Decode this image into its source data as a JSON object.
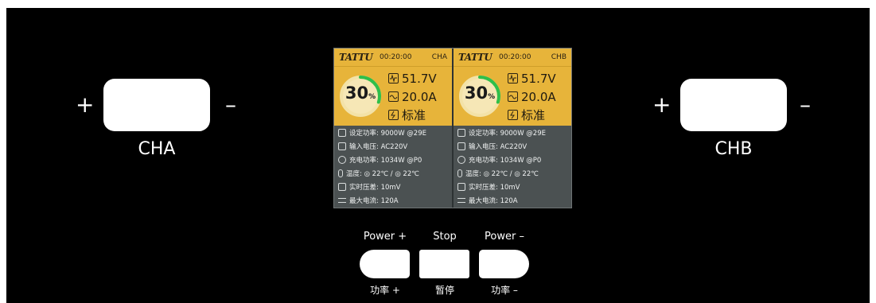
{
  "channels": {
    "a": {
      "label": "CHA",
      "plus": "+",
      "minus": "–"
    },
    "b": {
      "label": "CHB",
      "plus": "+",
      "minus": "–"
    }
  },
  "lcd": {
    "logo": "TATTU",
    "a": {
      "time": "00:20:00",
      "channel": "CHA",
      "percent": "30",
      "percent_unit": "%",
      "percent_value": 30,
      "voltage": "51.7V",
      "current": "20.0A",
      "mode": "标准",
      "info": [
        {
          "icon": "power-setting-icon",
          "text": "设定功率: 9000W  @29E"
        },
        {
          "icon": "input-voltage-icon",
          "text": "输入电压: AC220V"
        },
        {
          "icon": "charge-power-icon",
          "text": "充电功率: 1034W  @P0"
        },
        {
          "icon": "thermometer-icon",
          "text": "温度: ◎ 22℃ / ◎ 22℃"
        },
        {
          "icon": "cell-diff-icon",
          "text": "实时压差: 10mV"
        },
        {
          "icon": "max-current-icon",
          "text": "最大电流: 120A"
        }
      ]
    },
    "b": {
      "time": "00:20:00",
      "channel": "CHB",
      "percent": "30",
      "percent_unit": "%",
      "percent_value": 30,
      "voltage": "51.7V",
      "current": "20.0A",
      "mode": "标准",
      "info": [
        {
          "icon": "power-setting-icon",
          "text": "设定功率: 9000W  @29E"
        },
        {
          "icon": "input-voltage-icon",
          "text": "输入电压: AC220V"
        },
        {
          "icon": "charge-power-icon",
          "text": "充电功率: 1034W  @P0"
        },
        {
          "icon": "thermometer-icon",
          "text": "温度: ◎ 22℃ / ◎ 22℃"
        },
        {
          "icon": "cell-diff-icon",
          "text": "实时压差: 10mV"
        },
        {
          "icon": "max-current-icon",
          "text": "最大电流: 120A"
        }
      ]
    }
  },
  "controls": {
    "power_up": {
      "label_en": "Power +",
      "label_cn": "功率 +"
    },
    "stop": {
      "label_en": "Stop",
      "label_cn": "暂停"
    },
    "power_down": {
      "label_en": "Power –",
      "label_cn": "功率 –"
    }
  },
  "colors": {
    "panel": "#000000",
    "lcd_yellow": "#e7b43a",
    "lcd_gray": "#4b5152",
    "ring_green": "#2fbf4a"
  }
}
